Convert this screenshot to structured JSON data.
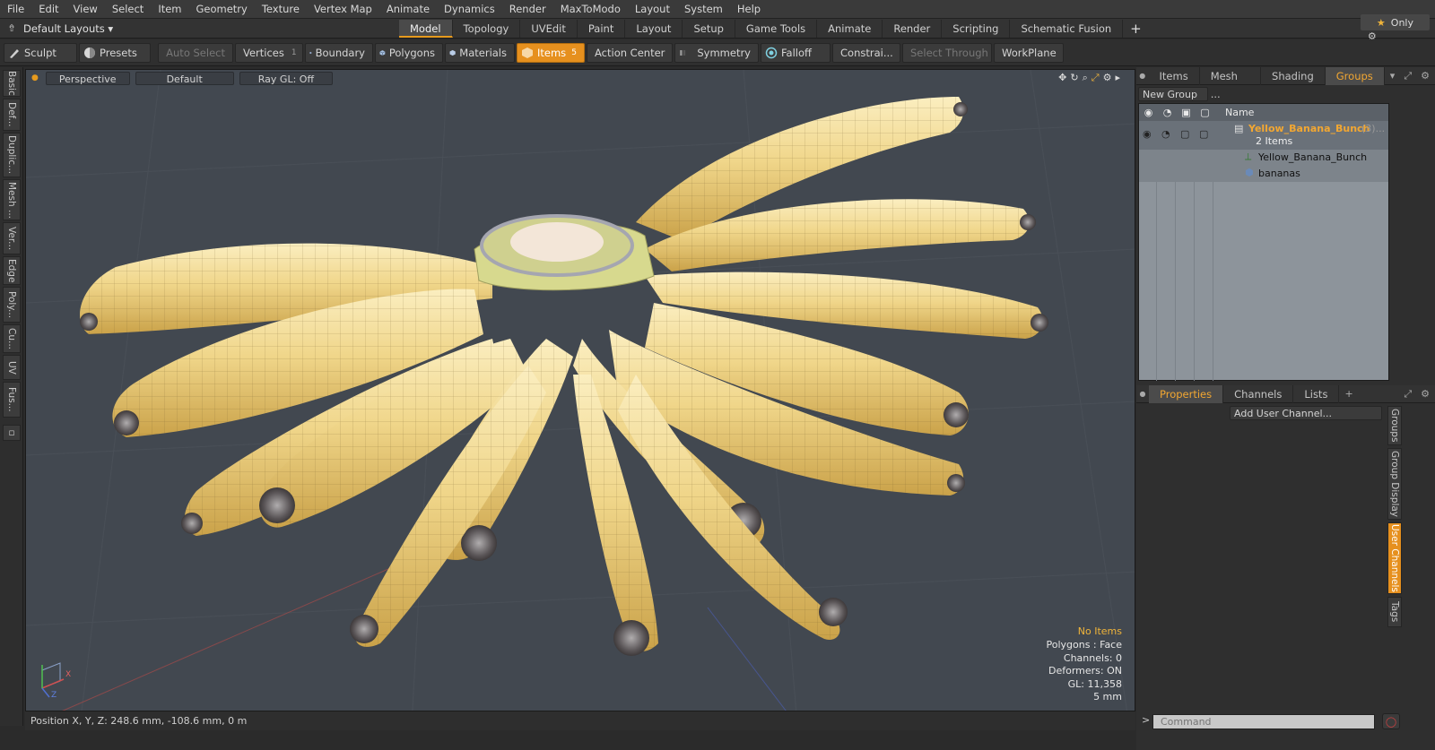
{
  "menus": [
    "File",
    "Edit",
    "View",
    "Select",
    "Item",
    "Geometry",
    "Texture",
    "Vertex Map",
    "Animate",
    "Dynamics",
    "Render",
    "MaxToModo",
    "Layout",
    "System",
    "Help"
  ],
  "layout": {
    "selector": "Default Layouts",
    "tabs": [
      "Model",
      "Topology",
      "UVEdit",
      "Paint",
      "Layout",
      "Setup",
      "Game Tools",
      "Animate",
      "Render",
      "Scripting",
      "Schematic Fusion"
    ],
    "active_tab": "Model",
    "only_label": "Only"
  },
  "toolbar": {
    "sculpt": "Sculpt",
    "presets": "Presets",
    "auto_select": "Auto Select",
    "vertices": "Vertices",
    "vertices_count": "1",
    "boundary": "Boundary",
    "polygons": "Polygons",
    "materials": "Materials",
    "items": "Items",
    "items_count": "5",
    "action_center": "Action Center",
    "symmetry": "Symmetry",
    "falloff": "Falloff",
    "constraints": "Constrai...",
    "select_through": "Select Through",
    "workplane": "WorkPlane"
  },
  "left_tabs": [
    "Basic",
    "Def...",
    "Duplic...",
    "Mesh ...",
    "Ver...",
    "Edge",
    "Poly...",
    "Cu...",
    "UV",
    "Fus..."
  ],
  "viewport": {
    "view": "Perspective",
    "shading": "Default",
    "raygl": "Ray GL: Off",
    "stats": {
      "items": "No Items",
      "polygons": "Polygons : Face",
      "channels": "Channels: 0",
      "deformers": "Deformers: ON",
      "gl": "GL: 11,358",
      "scale": "5 mm"
    },
    "axis_x": "X",
    "axis_z": "Z"
  },
  "status": {
    "position": "Position X, Y, Z:  248.6 mm, -108.6 mm, 0 m"
  },
  "right_top": {
    "tabs": [
      "Items",
      "Mesh ...",
      "Shading",
      "Groups"
    ],
    "active_tab": "Groups",
    "new_group": "New Group",
    "column_name": "Name",
    "group_name": "Yellow_Banana_Bunch",
    "group_count": "(3)...",
    "group_subtitle": "2 Items",
    "children": [
      "Yellow_Banana_Bunch",
      "bananas"
    ]
  },
  "right_bottom": {
    "tabs": [
      "Properties",
      "Channels",
      "Lists"
    ],
    "active_tab": "Properties",
    "add_user_channel": "Add User Channel...",
    "side_tabs": [
      "Groups",
      "Group Display",
      "User Channels",
      "Tags"
    ],
    "active_side_tab": "User Channels"
  },
  "command": {
    "prompt": ">",
    "placeholder": "Command"
  },
  "colors": {
    "accent": "#e6901e",
    "group_highlight": "#f2a732",
    "viewport_bg": "#424850"
  }
}
